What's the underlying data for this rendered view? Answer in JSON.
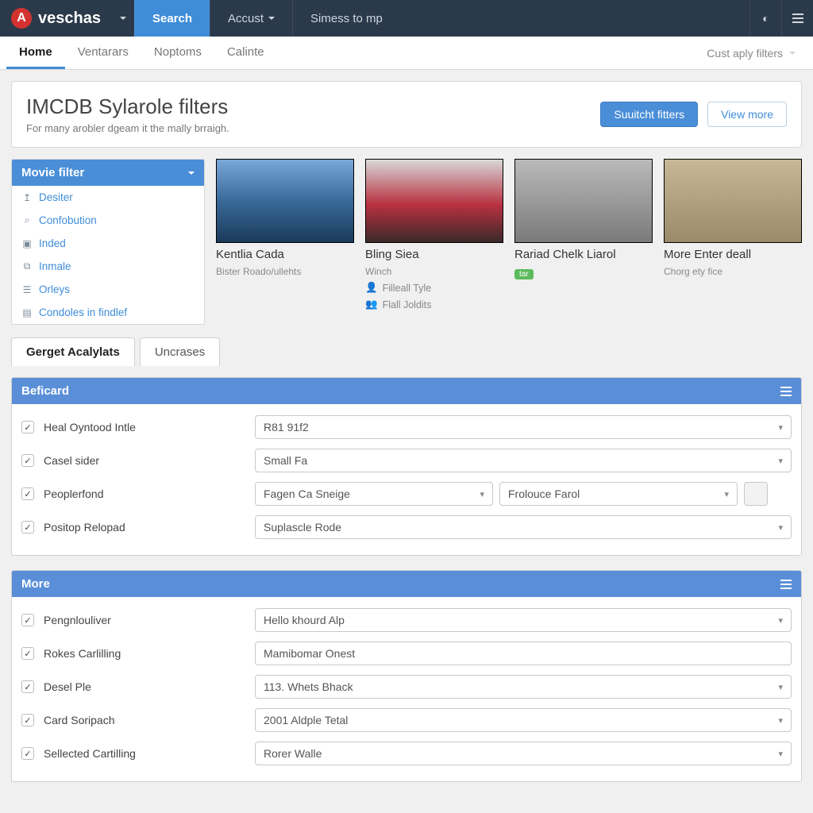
{
  "brand": "veschas",
  "topnav": {
    "search": "Search",
    "account": "Accust",
    "simess": "Simess to mp"
  },
  "secnav": {
    "home": "Home",
    "ventarars": "Ventarars",
    "noptoms": "Noptoms",
    "calinte": "Calinte",
    "filters_label": "Cust aply filters"
  },
  "hero": {
    "title": "IMCDB Sylarole filters",
    "subtitle": "For many arobler dgeam it the mally brraigh.",
    "btn_primary": "Suuitcht fitters",
    "btn_secondary": "View more"
  },
  "sidebar": {
    "title": "Movie filter",
    "items": [
      {
        "icon": "↥",
        "label": "Desiter"
      },
      {
        "icon": "⌕",
        "label": "Confobution"
      },
      {
        "icon": "▣",
        "label": "Inded"
      },
      {
        "icon": "⧉",
        "label": "Inmale"
      },
      {
        "icon": "☰",
        "label": "Orleys"
      },
      {
        "icon": "▤",
        "label": "Condoles in findlef"
      }
    ]
  },
  "thumbs": [
    {
      "title": "Kentlia Cada",
      "sub": "Bister Roado/ullehts",
      "img": "blue"
    },
    {
      "title": "Bling Siea",
      "sub": "Winch",
      "img": "red",
      "meta": [
        {
          "icon": "👤",
          "text": "Filleall Tyle"
        },
        {
          "icon": "👥",
          "text": "Flall Joldits"
        }
      ]
    },
    {
      "title": "Rariad Chelk Liarol",
      "sub": "",
      "img": "grey",
      "badge": "tar"
    },
    {
      "title": "More Enter deall",
      "sub": "Chorg ety fice",
      "img": "tan"
    }
  ],
  "tabs": {
    "a": "Gerget Acalylats",
    "b": "Uncrases"
  },
  "panel1": {
    "title": "Beficard",
    "rows": [
      {
        "label": "Heal Oyntood Intle",
        "fields": [
          {
            "type": "sel",
            "value": "R81 91f2"
          }
        ]
      },
      {
        "label": "Casel sider",
        "fields": [
          {
            "type": "sel",
            "value": "Small Fa"
          }
        ]
      },
      {
        "label": "Peoplerfond",
        "fields": [
          {
            "type": "sel",
            "value": "Fagen Ca Sneige",
            "narrow": true
          },
          {
            "type": "sel",
            "value": "Frolouce Farol",
            "narrow": true
          },
          {
            "type": "sq"
          }
        ]
      },
      {
        "label": "Positop Relopad",
        "fields": [
          {
            "type": "sel",
            "value": "Suplascle Rode"
          }
        ]
      }
    ]
  },
  "panel2": {
    "title": "More",
    "rows": [
      {
        "label": "Pengnlouliver",
        "fields": [
          {
            "type": "sel",
            "value": "Hello khourd Alp"
          }
        ]
      },
      {
        "label": "Rokes Carlilling",
        "fields": [
          {
            "type": "inp",
            "value": "Mamibomar Onest"
          }
        ]
      },
      {
        "label": "Desel Ple",
        "fields": [
          {
            "type": "sel",
            "value": "113. Whets Bhack"
          }
        ]
      },
      {
        "label": "Card Soripach",
        "fields": [
          {
            "type": "sel",
            "value": "2001 Aldple Tetal"
          }
        ]
      },
      {
        "label": "Sellected Cartilling",
        "fields": [
          {
            "type": "sel",
            "value": "Rorer Walle"
          }
        ]
      }
    ]
  }
}
